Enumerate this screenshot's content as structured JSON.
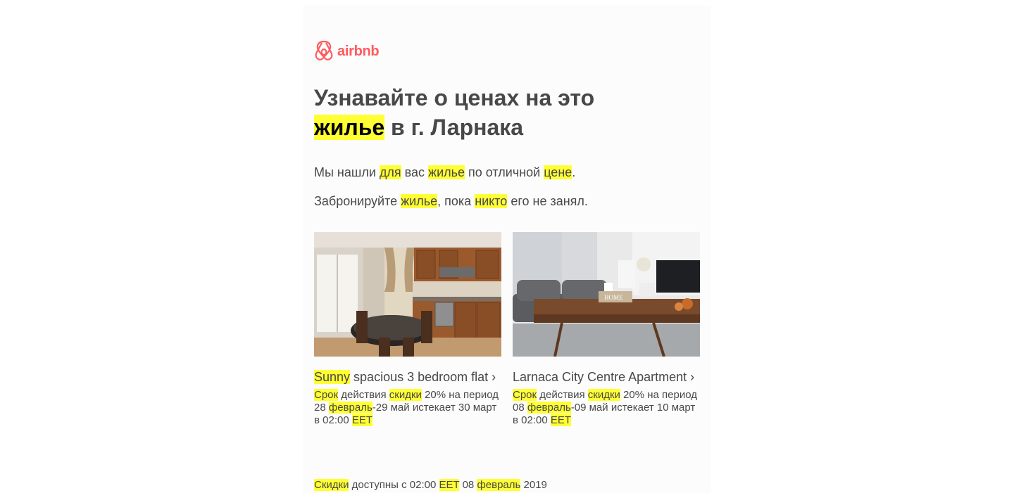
{
  "brand": {
    "logo_text": "airbnb",
    "color": "#ff5a5f"
  },
  "highlight_color": "#ffff33",
  "heading": {
    "line1": "Узнавайте о ценах на это",
    "line2_hl": "жилье",
    "line2_rest": " в г. Ларнака"
  },
  "intro": {
    "p1": [
      "Мы нашли ",
      "для",
      " вас ",
      "жилье",
      " по отличной ",
      "цене",
      "."
    ],
    "p2": [
      "Забронируйте ",
      "жилье",
      ", пока ",
      "никто",
      " его не занял."
    ]
  },
  "listings": [
    {
      "photo": "kitchen-dining-photo",
      "title_hl": "Sunny",
      "title_rest": " spacious 3 bedroom flat ›",
      "desc": [
        "Срок",
        " действия ",
        "скидки",
        " 20% на период 28 ",
        "февраль",
        "-29 май истекает 30 март в 02:00 ",
        "EET"
      ]
    },
    {
      "photo": "living-room-photo",
      "title_hl": "",
      "title_rest": "Larnaca City Centre Apartment ›",
      "desc": [
        "Срок",
        " действия ",
        "скидки",
        " 20% на период 08 ",
        "февраль",
        "-09 май истекает 10 март в 02:00 ",
        "EET"
      ]
    }
  ],
  "footer": [
    "Скидки",
    " доступны с 02:00 ",
    "EET",
    " 08 ",
    "февраль",
    " 2019"
  ]
}
